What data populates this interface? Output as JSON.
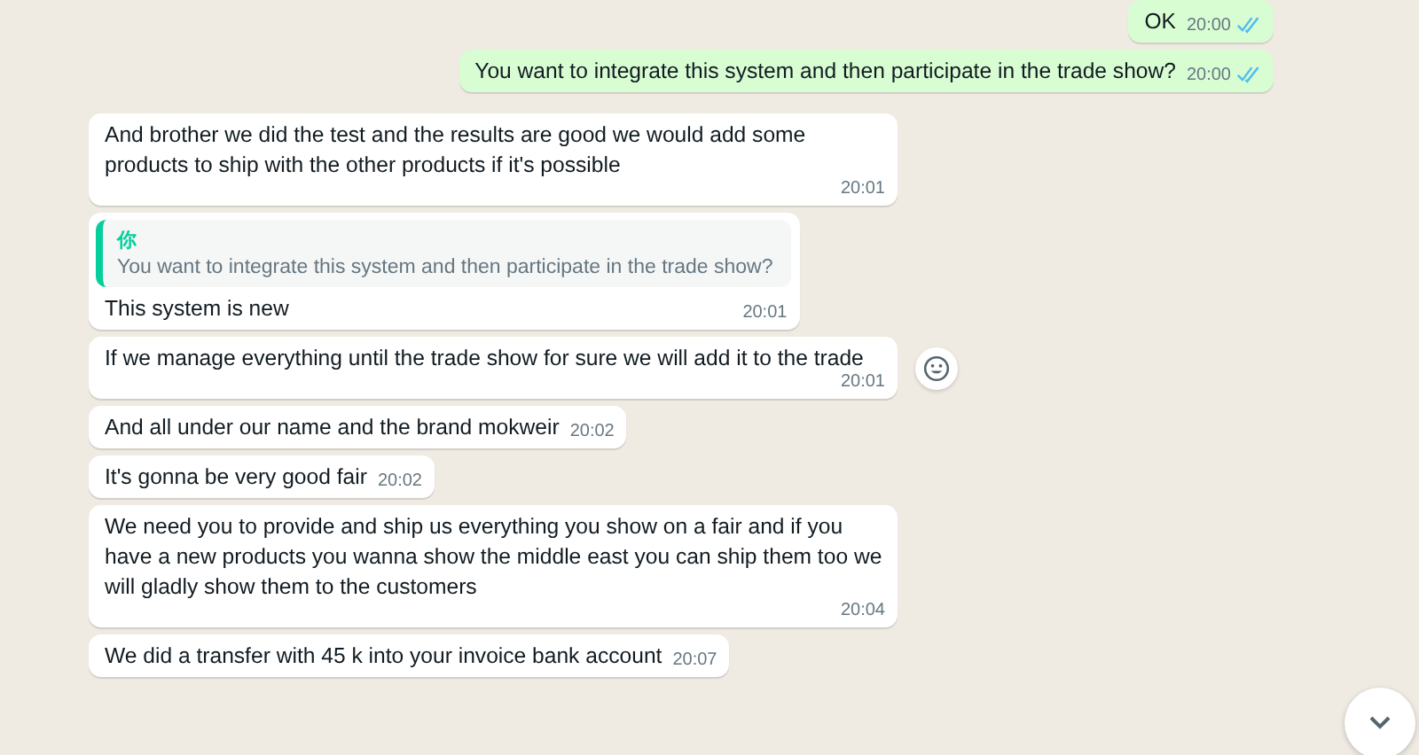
{
  "messages": [
    {
      "outgoing": true,
      "text": "OK",
      "time": "20:00",
      "read": true
    },
    {
      "outgoing": true,
      "text": "You want to integrate this system and then participate in the trade show?",
      "time": "20:00",
      "read": true
    },
    {
      "outgoing": false,
      "text": "And brother we did the test and the results are good we would add some products to ship with the other products if it's possible",
      "time": "20:01"
    },
    {
      "outgoing": false,
      "quote": {
        "author": "你",
        "text": "You want to integrate this system and then participate in the trade show?"
      },
      "text": "This system is new",
      "time": "20:01"
    },
    {
      "outgoing": false,
      "text": "If we manage everything until the trade show for sure we will add it to the trade",
      "time": "20:01",
      "hovered": true
    },
    {
      "outgoing": false,
      "text": "And all under our name and the brand mokweir",
      "time": "20:02"
    },
    {
      "outgoing": false,
      "text": "It's gonna be very good fair",
      "time": "20:02"
    },
    {
      "outgoing": false,
      "text": "We need you to provide and ship us everything you show on a fair and if you have a new products you wanna show the middle east you can ship them too we will gladly show them to the customers",
      "time": "20:04"
    },
    {
      "outgoing": false,
      "text": "We did a transfer with 45 k into your invoice bank account",
      "time": "20:07"
    }
  ]
}
